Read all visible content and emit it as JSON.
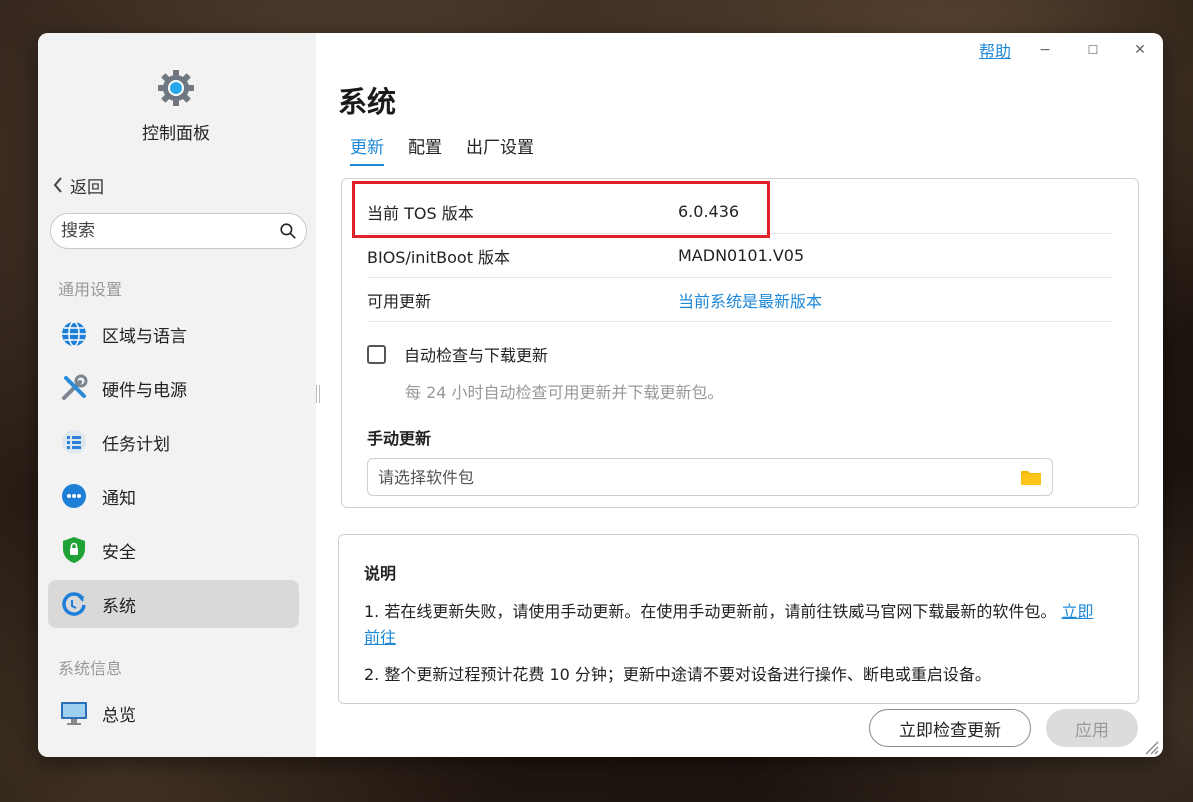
{
  "window": {
    "help_label": "帮助",
    "minimize_label": "−",
    "maximize_label": "☐",
    "close_label": "✕"
  },
  "sidebar": {
    "app_title": "控制面板",
    "back_label": "返回",
    "search_placeholder": "搜索",
    "group1_label": "通用设置",
    "items": [
      {
        "label": "区域与语言",
        "icon": "globe-icon"
      },
      {
        "label": "硬件与电源",
        "icon": "tools-icon"
      },
      {
        "label": "任务计划",
        "icon": "task-list-icon"
      },
      {
        "label": "通知",
        "icon": "chat-bubble-icon"
      },
      {
        "label": "安全",
        "icon": "shield-icon"
      },
      {
        "label": "系统",
        "icon": "system-update-icon",
        "active": true
      }
    ],
    "group2_label": "系统信息",
    "info_items": [
      {
        "label": "总览",
        "icon": "monitor-icon"
      }
    ]
  },
  "main": {
    "title": "系统",
    "tabs": [
      {
        "label": "更新",
        "active": true
      },
      {
        "label": "配置"
      },
      {
        "label": "出厂设置"
      }
    ],
    "info_rows": [
      {
        "key": "当前 TOS 版本",
        "value": "6.0.436"
      },
      {
        "key": "BIOS/initBoot 版本",
        "value": "MADN0101.V05"
      },
      {
        "key": "可用更新",
        "value": "当前系统是最新版本"
      }
    ],
    "auto_update_label": "自动检查与下载更新",
    "auto_update_checked": false,
    "auto_update_hint": "每 24 小时自动检查可用更新并下载更新包。",
    "manual_update_title": "手动更新",
    "file_placeholder": "请选择软件包"
  },
  "notes": {
    "title": "说明",
    "note1_text": "1. 若在线更新失败，请使用手动更新。在使用手动更新前，请前往铁威马官网下载最新的软件包。",
    "note1_link": "立即前往",
    "note2_text": "2. 整个更新过程预计花费 10 分钟；更新中途请不要对设备进行操作、断电或重启设备。"
  },
  "footer": {
    "check_button": "立即检查更新",
    "apply_button": "应用"
  },
  "colors": {
    "accent": "#1e88d8",
    "highlight_border": "#e0202a",
    "sidebar_bg": "#f2f2f2"
  }
}
